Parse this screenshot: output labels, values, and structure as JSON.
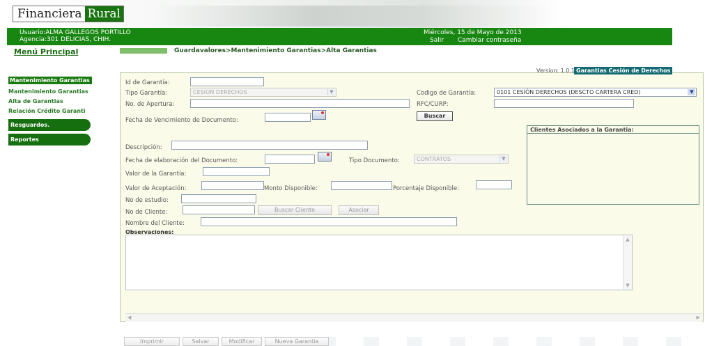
{
  "header": {
    "logo_part1": "Financiera",
    "logo_part2": "Rural",
    "user": "Usuario:ALMA GALLEGOS PORTILLO",
    "agency": "Agencia:301 DELICIAS, CHIH.",
    "date": "Miércoles, 15 de Mayo de 2013",
    "salir": "Salir",
    "cambiar": "Cambiar contraseña"
  },
  "nav": {
    "menu_principal": "Menú Principal",
    "breadcrumb": "Guardavalores>Mantenimiento Garantias>Alta Garantias"
  },
  "sidebar": {
    "items": [
      {
        "label": "Mantenimiento Garantias"
      },
      {
        "label": "Mantenimiento Garantias"
      },
      {
        "label": "Alta de Garantias"
      },
      {
        "label": "Relación Crédito Garanti"
      }
    ],
    "pills": [
      {
        "label": "Resguardos."
      },
      {
        "label": "Reportes"
      }
    ]
  },
  "form": {
    "version_label": "Version: 1.0.11",
    "version_badge": "Garantias Cesión de Derechos",
    "id_garantia_label": "Id de Garantía:",
    "tipo_garantia_label": "Tipo Garantía:",
    "tipo_garantia_value": "CESION DERECHOS",
    "codigo_garantia_label": "Codigo de Garantía:",
    "codigo_garantia_value": "0101 CESIÓN DERECHOS (DESCTO CARTERA CRED)",
    "no_apertura_label": "No. de Apertura:",
    "rfc_label": "RFC/CURP:",
    "fecha_vencimiento_label": "Fecha de Vencimiento de Documento:",
    "buscar_button": "Buscar",
    "clientes_title": "Clientes Asociados a la Garantia:",
    "descripcion_label": "Descripción:",
    "fecha_elaboracion_label": "Fecha de elaboración del Documento:",
    "tipo_documento_label": "Tipo Documento:",
    "tipo_documento_value": "CONTRATOS",
    "valor_garantia_label": "Valor de la Garantía:",
    "valor_aceptacion_label": "Valor de Aceptación:",
    "monto_disponible_label": "Monto Disponible:",
    "porcentaje_disponible_label": "Porcentaje Disponible:",
    "no_estudio_label": "No de estudio:",
    "no_cliente_label": "No de Cliente:",
    "buscar_cliente_button": "Buscar Cliente",
    "asociar_button": "Asociar",
    "nombre_cliente_label": "Nombre del Cliente:",
    "observaciones_label": "Observaciones:"
  },
  "footer_buttons": {
    "imprimir": "Imprimir",
    "salvar": "Salvar",
    "modificar": "Modificar",
    "nueva_garantia": "Nueva Garantia"
  },
  "colors": {
    "brand_green": "#188712",
    "badge_teal": "#146b73"
  }
}
